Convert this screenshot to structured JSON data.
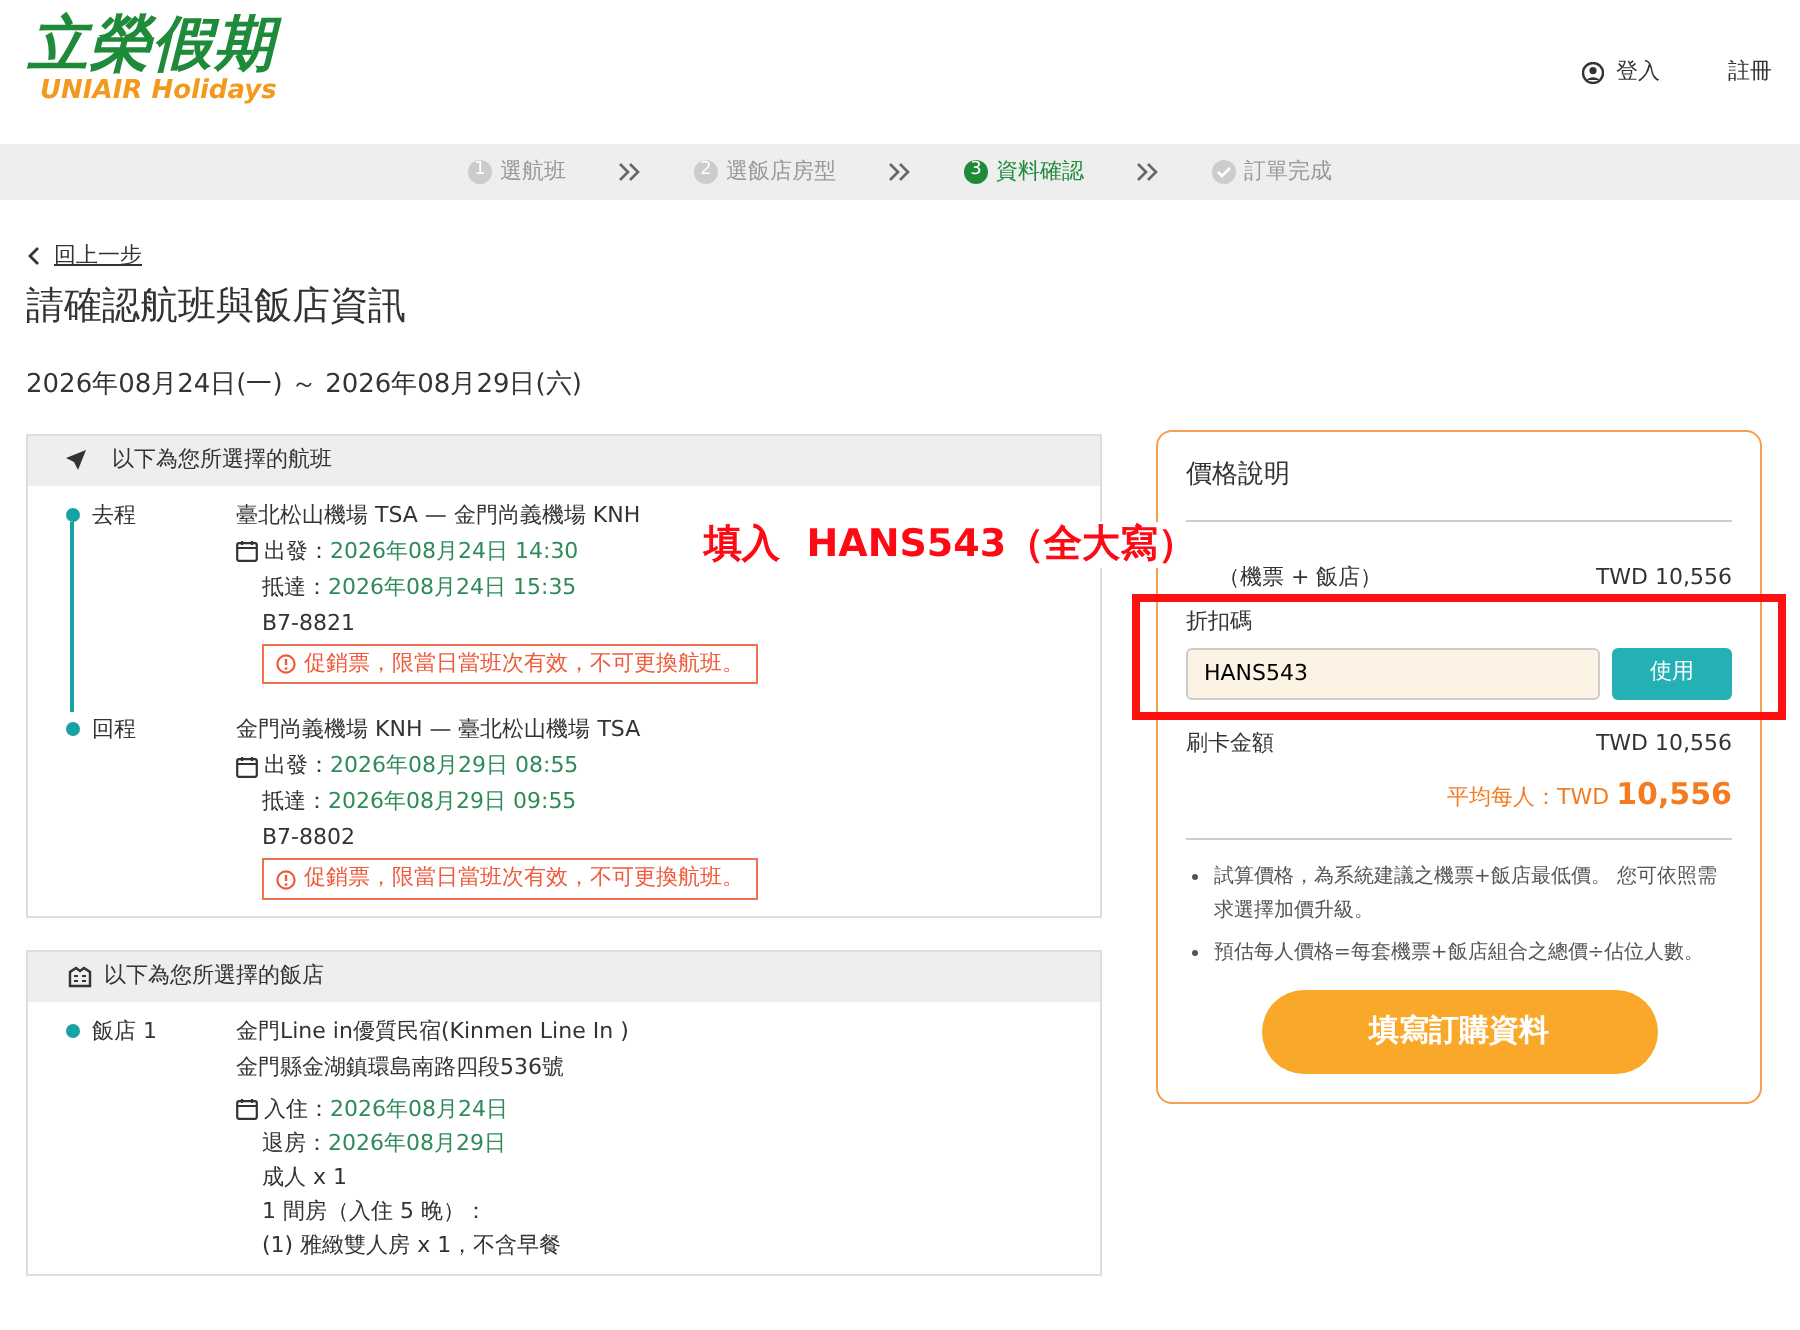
{
  "header": {
    "logo": {
      "title": "立榮假期",
      "subtitle": "UNIAIR Holidays"
    },
    "links": [
      {
        "label": "登入",
        "kind": "login"
      },
      {
        "label": "註冊",
        "kind": "plain"
      }
    ]
  },
  "steps": [
    {
      "number": "1",
      "label": "選航班",
      "selected": false
    },
    {
      "number": "2",
      "label": "選飯店房型",
      "selected": false
    },
    {
      "number": "3",
      "label": "資料確認",
      "selected": true
    },
    {
      "label": "訂單完成",
      "selected": false
    }
  ],
  "back_link": "回上一步",
  "page_title": "請確認航班與飯店資訊",
  "date_range": "2026年08月24日(一) ～ 2026年08月29日(六)",
  "flights": {
    "heading": "以下為您所選擇的航班",
    "legs": [
      {
        "label": "去程",
        "route": "臺北松山機場 TSA — 金門尚義機場 KNH",
        "depart_label": "出發：",
        "depart": "2026年08月24日 14:30",
        "arrive_label": "抵達：",
        "arrive": "2026年08月24日 15:35",
        "flight": "B7-8821",
        "notice": "促銷票，限當日當班次有效，不可更換航班。"
      },
      {
        "label": "回程",
        "route": "金門尚義機場 KNH — 臺北松山機場 TSA",
        "depart_label": "出發：",
        "depart": "2026年08月29日 08:55",
        "arrive_label": "抵達：",
        "arrive": "2026年08月29日 09:55",
        "flight": "B7-8802",
        "notice": "促銷票，限當日當班次有效，不可更換航班。"
      }
    ]
  },
  "hotels": {
    "heading": "以下為您所選擇的飯店",
    "items": [
      {
        "label": "飯店 1",
        "name": "金門Line in優質民宿(Kinmen Line In )",
        "address": "金門縣金湖鎮環島南路四段536號",
        "checkin_label": "入住：",
        "checkin": "2026年08月24日",
        "checkout_label": "退房：",
        "checkout": "2026年08月29日",
        "lines": [
          "成人 x 1",
          "1 間房（入住 5 晚）：",
          "(1) 雅緻雙人房 x 1，不含早餐"
        ]
      }
    ]
  },
  "price": {
    "title": "價格說明",
    "total": {
      "label": "（機票 + 飯店）",
      "value": "TWD 10,556"
    },
    "discount": {
      "label": "折扣碼",
      "value": "HANS543",
      "button": "使用"
    },
    "card": {
      "label": "刷卡金額",
      "value": "TWD 10,556"
    },
    "average": {
      "label": "平均每人：",
      "currency": "TWD",
      "amount": "10,556"
    },
    "notes": [
      "試算價格，為系統建議之機票+飯店最低價。 您可依照需求選擇加價升級。",
      "預估每人價格=每套機票+飯店組合之總價÷佔位人數。"
    ],
    "cta": "填寫訂購資料"
  },
  "annotation": {
    "text": "填入  HANS543（全大寫）"
  }
}
